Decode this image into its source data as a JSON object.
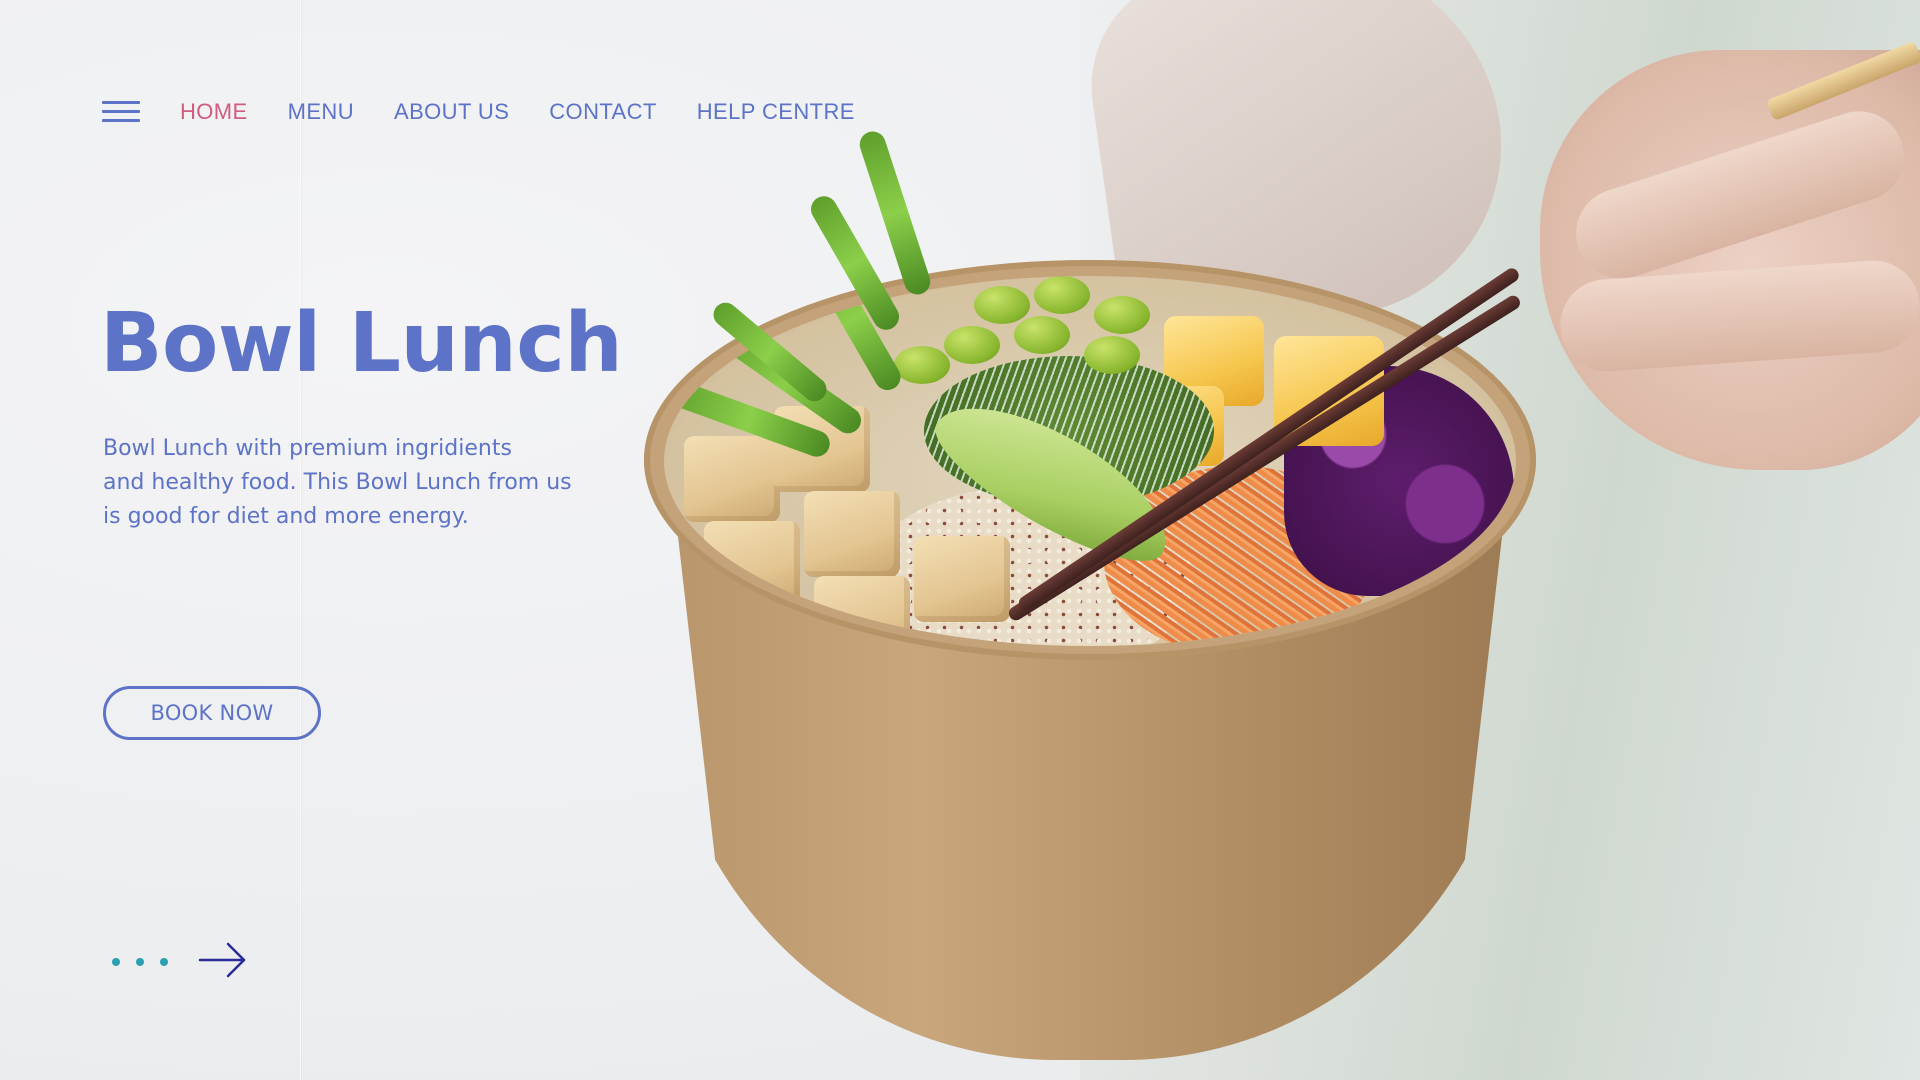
{
  "nav": {
    "menu_icon": "hamburger-menu-icon",
    "items": [
      {
        "label": "HOME",
        "active": true
      },
      {
        "label": "MENU",
        "active": false
      },
      {
        "label": "ABOUT US",
        "active": false
      },
      {
        "label": "CONTACT",
        "active": false
      },
      {
        "label": "HELP CENTRE",
        "active": false
      }
    ]
  },
  "hero": {
    "title": "Bowl Lunch",
    "description_lines": [
      "Bowl Lunch with premium ingridients",
      "and healthy food. This Bowl Lunch from us",
      "is good for diet and more energy."
    ],
    "cta_label": "BOOK NOW"
  },
  "pager": {
    "dots": 3,
    "next_icon": "arrow-right-icon"
  },
  "colors": {
    "primary": "#5d73c7",
    "active_nav": "#d05c7e",
    "dot_accent": "#2aa0b5",
    "arrow": "#2a2a9a"
  }
}
